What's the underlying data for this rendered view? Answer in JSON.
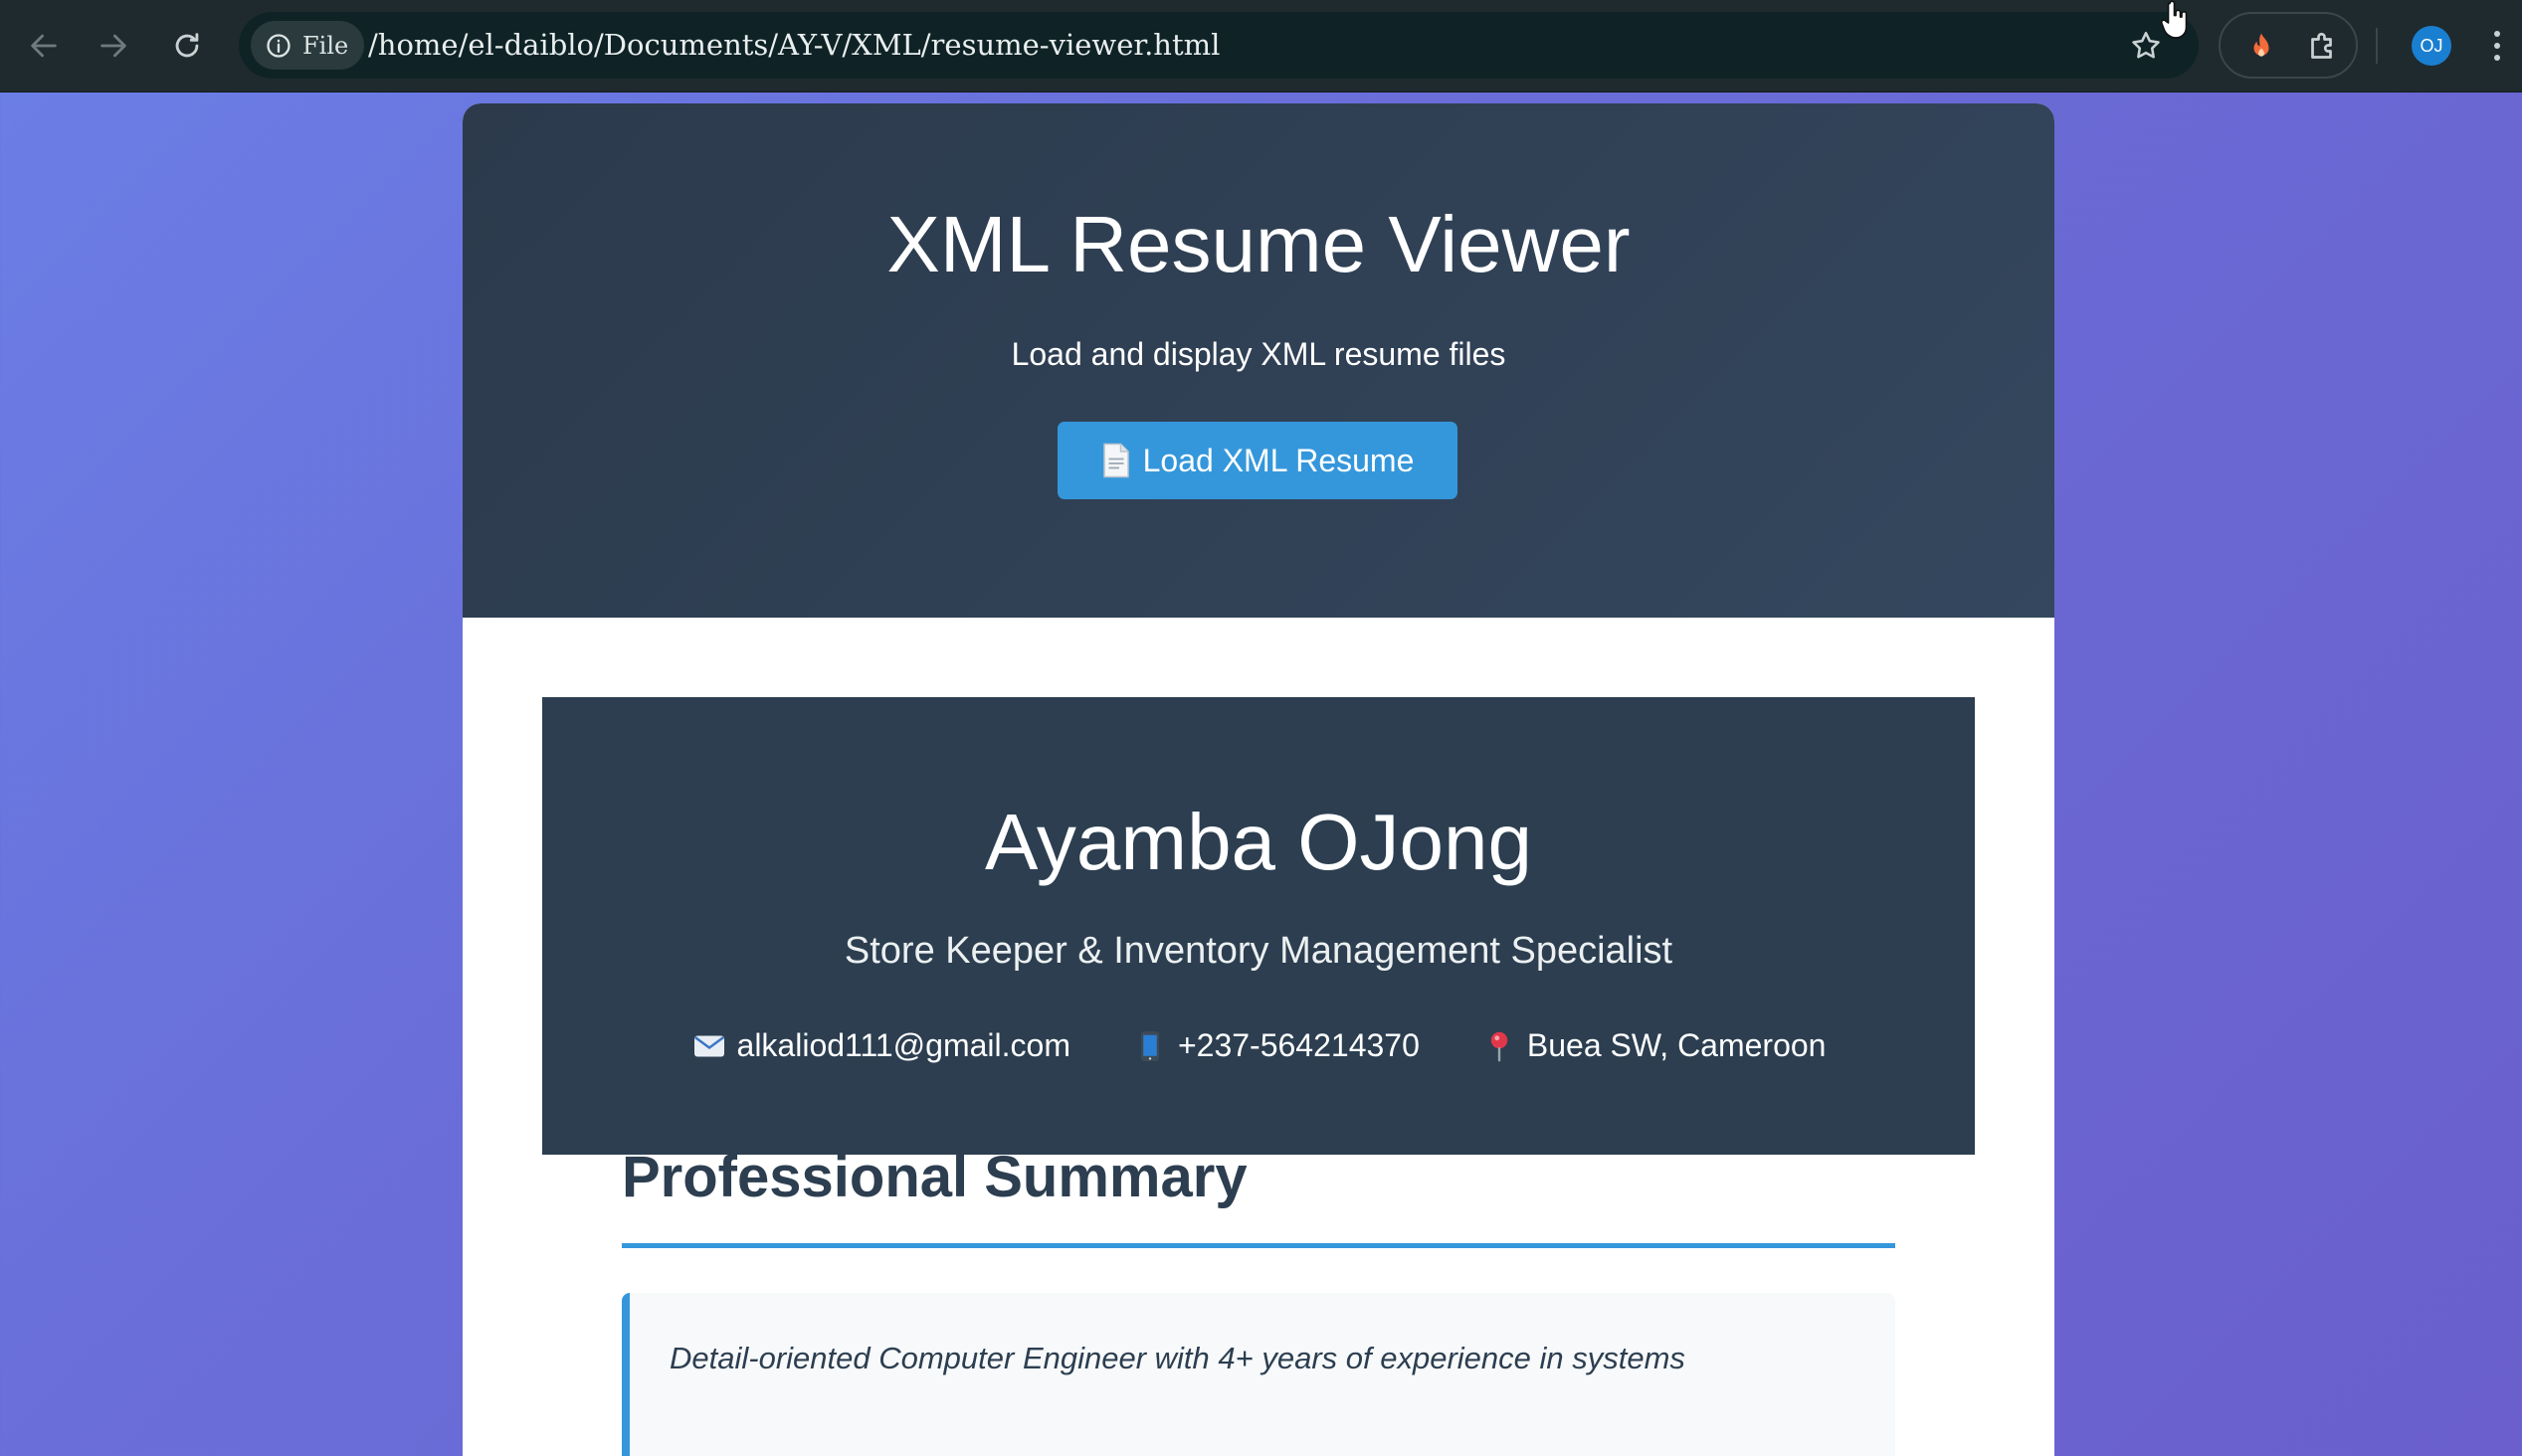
{
  "browser": {
    "chip_label": "File",
    "url": "/home/el-daiblo/Documents/AY-V/XML/resume-viewer.html",
    "avatar_initials": "OJ"
  },
  "hero": {
    "title": "XML Resume Viewer",
    "subtitle": "Load and display XML resume files",
    "load_button_label": "Load XML Resume"
  },
  "resume": {
    "name": "Ayamba OJong",
    "role": "Store Keeper & Inventory Management Specialist",
    "email": "alkaliod111@gmail.com",
    "phone": "+237-564214370",
    "location": "Buea SW, Cameroon"
  },
  "summary": {
    "heading": "Professional Summary",
    "text": "Detail-oriented Computer Engineer with 4+ years of experience in systems"
  },
  "colors": {
    "accent": "#3597db",
    "header_dark": "#2c3e50"
  }
}
